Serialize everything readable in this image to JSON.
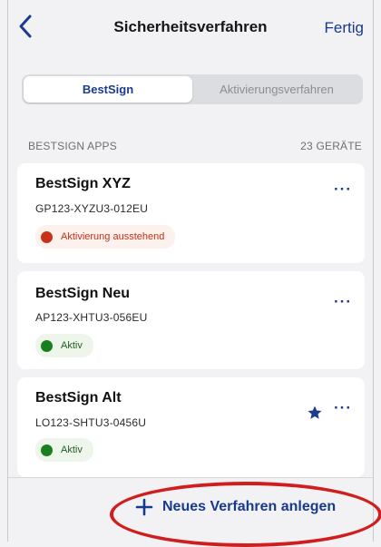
{
  "header": {
    "title": "Sicherheitsverfahren",
    "done_label": "Fertig"
  },
  "tabs": [
    {
      "label": "BestSign",
      "active": true
    },
    {
      "label": "Aktivierungsverfahren",
      "active": false
    }
  ],
  "section": {
    "title": "BESTSIGN APPS",
    "count": "23 GERÄTE"
  },
  "apps": [
    {
      "name": "BestSign XYZ",
      "serial": "GP123-XYZU3-012EU",
      "status": "Aktivierung ausstehend",
      "status_type": "pending",
      "more": "···"
    },
    {
      "name": "BestSign Neu",
      "serial": "AP123-XHTU3-056EU",
      "status": "Aktiv",
      "status_type": "active",
      "more": "···"
    },
    {
      "name": "BestSign Alt",
      "serial": "LO123-SHTU3-0456U",
      "status": "Aktiv",
      "status_type": "active",
      "favorite": true,
      "more": "···"
    }
  ],
  "footer": {
    "new_label": "Neues Verfahren anlegen"
  },
  "colors": {
    "accent": "#1b3b8f",
    "pending": "#c8321a",
    "active": "#1a7f1f",
    "highlight": "#d01e1e"
  }
}
